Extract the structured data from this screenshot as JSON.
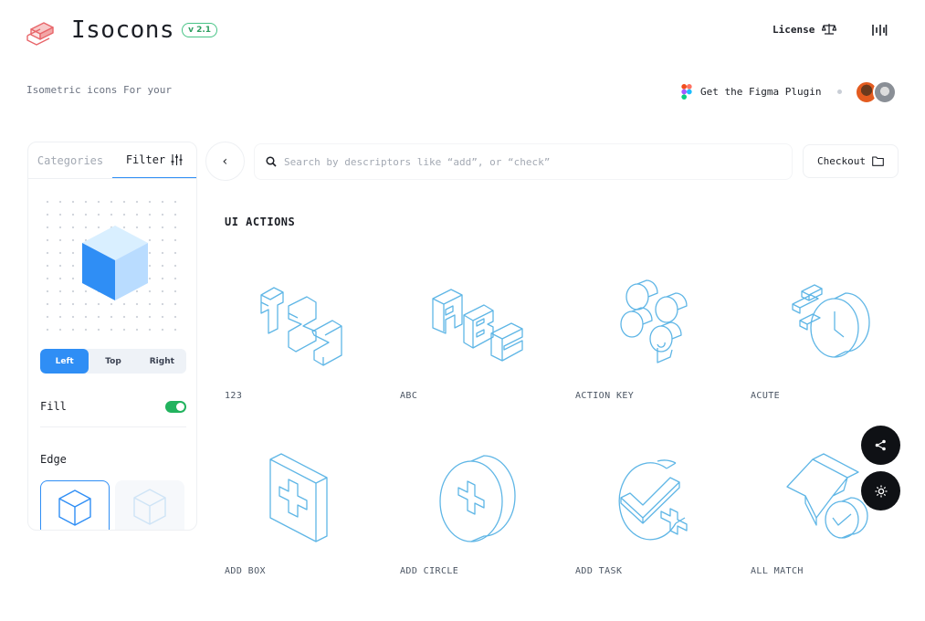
{
  "header": {
    "brand": "Isocons",
    "version": "v 2.1",
    "license_label": "License",
    "tagline": "Isometric icons For your",
    "figma_label": "Get the Figma Plugin"
  },
  "sidebar": {
    "tabs": [
      {
        "label": "Categories",
        "active": false
      },
      {
        "label": "Filter",
        "active": true
      }
    ],
    "face_options": [
      {
        "label": "Left",
        "active": true
      },
      {
        "label": "Top",
        "active": false
      },
      {
        "label": "Right",
        "active": false
      }
    ],
    "fill_label": "Fill",
    "fill_on": true,
    "edge_label": "Edge"
  },
  "search": {
    "placeholder": "Search by descriptors like “add”, or “check”",
    "value": ""
  },
  "checkout_label": "Checkout",
  "section_title": "UI ACTIONS",
  "icons": [
    {
      "name": "123",
      "glyph": "numbers-123-icon"
    },
    {
      "name": "ABC",
      "glyph": "letters-abc-icon"
    },
    {
      "name": "ACTION KEY",
      "glyph": "action-key-icon"
    },
    {
      "name": "ACUTE",
      "glyph": "acute-icon"
    },
    {
      "name": "ADD BOX",
      "glyph": "add-box-icon"
    },
    {
      "name": "ADD CIRCLE",
      "glyph": "add-circle-icon"
    },
    {
      "name": "ADD TASK",
      "glyph": "add-task-icon"
    },
    {
      "name": "ALL MATCH",
      "glyph": "all-match-icon"
    }
  ],
  "colors": {
    "accent": "#2f8ef5",
    "toggle_on": "#22b35e",
    "icon_stroke": "#5fb6e6",
    "badge": "#47c486",
    "logo": "#e8666a",
    "fab": "#0f1115"
  }
}
